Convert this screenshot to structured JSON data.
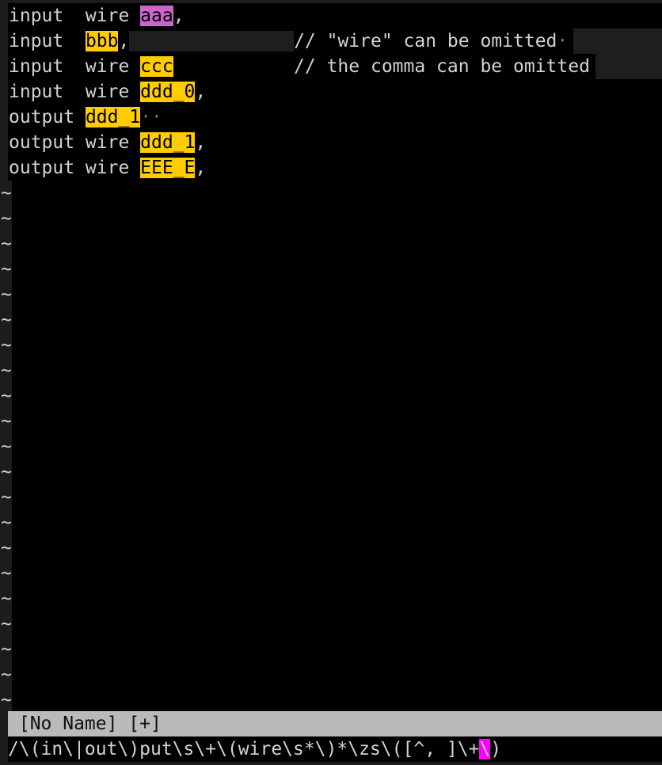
{
  "editor": {
    "lines": [
      {
        "pre": "input  wire ",
        "match": "aaa",
        "post": ",",
        "current": true
      },
      {
        "pre": "input  ",
        "match": "bbb",
        "post": ",",
        "ws": "               ",
        "comment": "// \"wire\" can be omitted",
        "dot": "·"
      },
      {
        "pre": "input  wire ",
        "match": "ccc",
        "post": "",
        "ws": "",
        "comment": "           // the comma can be omitted"
      },
      {
        "pre": "input  wire ",
        "match": "ddd_0",
        "post": ","
      },
      {
        "pre": "output ",
        "match": "ddd_1",
        "post": "",
        "dot": "··"
      },
      {
        "pre": "output wire ",
        "match": "ddd_1",
        "post": ","
      },
      {
        "pre": "output wire ",
        "match": "EEE_E",
        "post": ","
      }
    ],
    "empty_line_marker": "~",
    "empty_line_count": 21,
    "colors": {
      "match_highlight": "#ffcc00",
      "current_match": "#cc66cc",
      "cursor": "#ff00ff"
    }
  },
  "statusline": {
    "text": " [No Name] [+]"
  },
  "cmdline": {
    "before_cursor": "/\\(in\\|out\\)put\\s\\+\\(wire\\s*\\)*\\zs\\([^, ]\\+",
    "cursor_char": "\\",
    "after_cursor": ")"
  }
}
